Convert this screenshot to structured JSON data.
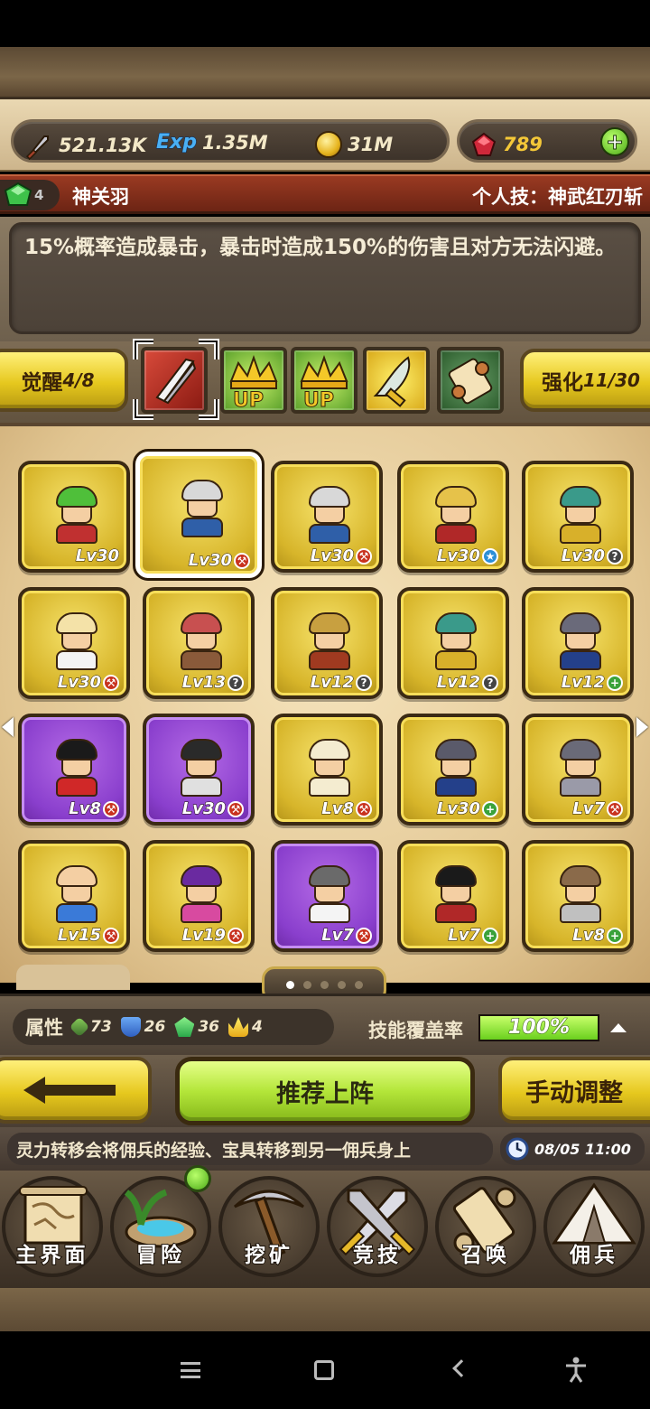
{
  "resources": {
    "attack": "521.13K",
    "exp_label": "Exp",
    "exp": "1.35M",
    "gold": "31M",
    "gems": "789"
  },
  "hero": {
    "gem_count": "4",
    "name": "神关羽",
    "skill": "个人技：神武红刃斩",
    "description": "15%概率造成暴击，暴击时造成150%的伤害且对方无法闪避。"
  },
  "awaken": {
    "label": "觉醒",
    "value": "4/8"
  },
  "enhance": {
    "label": "强化",
    "value": "11/30"
  },
  "skills": [
    {
      "icon": "crossed-swords-icon"
    },
    {
      "icon": "crown-up-icon",
      "label": "UP"
    },
    {
      "icon": "crown-up-icon",
      "label": "UP"
    },
    {
      "icon": "curved-blade-icon"
    },
    {
      "icon": "scroll-icon"
    }
  ],
  "mercenaries": [
    {
      "level": "Lv30",
      "badge": "",
      "color": "gold",
      "hair": "#4fbf3a",
      "outfit": "#c03030"
    },
    {
      "level": "Lv30",
      "badge": "fire",
      "color": "gold",
      "hair": "#d8d8d8",
      "outfit": "#2f5fa8",
      "selected": true
    },
    {
      "level": "Lv30",
      "badge": "fire",
      "color": "gold",
      "hair": "#d8d8d8",
      "outfit": "#2f5fa8"
    },
    {
      "level": "Lv30",
      "badge": "water",
      "color": "gold",
      "hair": "#e6c24a",
      "outfit": "#b02828"
    },
    {
      "level": "Lv30",
      "badge": "q",
      "color": "gold",
      "hair": "#3a9a8a",
      "outfit": "#d8b02a"
    },
    {
      "level": "Lv30",
      "badge": "fire",
      "color": "gold",
      "hair": "#f4e2a8",
      "outfit": "#f4f4f4"
    },
    {
      "level": "Lv13",
      "badge": "q",
      "color": "gold",
      "hair": "#c85050",
      "outfit": "#8a5a3a"
    },
    {
      "level": "Lv12",
      "badge": "q",
      "color": "gold",
      "hair": "#c8a040",
      "outfit": "#a03a20"
    },
    {
      "level": "Lv12",
      "badge": "q",
      "color": "gold",
      "hair": "#3a9a8a",
      "outfit": "#d8b02a"
    },
    {
      "level": "Lv12",
      "badge": "wind",
      "color": "gold",
      "hair": "#6a6a7a",
      "outfit": "#24408a"
    },
    {
      "level": "Lv8",
      "badge": "fire",
      "color": "purple",
      "hair": "#1a1a1a",
      "outfit": "#d02828"
    },
    {
      "level": "Lv30",
      "badge": "fire",
      "color": "purple",
      "hair": "#2a2a2a",
      "outfit": "#e0e0e0"
    },
    {
      "level": "Lv8",
      "badge": "fire",
      "color": "gold",
      "hair": "#f4ecd0",
      "outfit": "#f4ecd0"
    },
    {
      "level": "Lv30",
      "badge": "wind",
      "color": "gold",
      "hair": "#5a5a6a",
      "outfit": "#24408a"
    },
    {
      "level": "Lv7",
      "badge": "fire",
      "color": "gold",
      "hair": "#6a6a78",
      "outfit": "#9a9aa8"
    },
    {
      "level": "Lv15",
      "badge": "fire",
      "color": "gold",
      "hair": "#f4cfa3",
      "outfit": "#3a7ad8"
    },
    {
      "level": "Lv19",
      "badge": "fire",
      "color": "gold",
      "hair": "#6a2aa0",
      "outfit": "#d84aa0"
    },
    {
      "level": "Lv7",
      "badge": "fire",
      "color": "purple",
      "hair": "#6a6a6a",
      "outfit": "#f4f4f4"
    },
    {
      "level": "Lv7",
      "badge": "wind",
      "color": "gold",
      "hair": "#1a1a1a",
      "outfit": "#b02828"
    },
    {
      "level": "Lv8",
      "badge": "wind",
      "color": "gold",
      "hair": "#8a6a4a",
      "outfit": "#c0c0c0"
    }
  ],
  "attributes": {
    "label": "属性",
    "stats": [
      {
        "icon": "leaf-sword-icon",
        "value": "73",
        "color": "#4a8a3a"
      },
      {
        "icon": "shield-icon",
        "value": "26",
        "color": "#2f6fd0"
      },
      {
        "icon": "emerald-icon",
        "value": "36",
        "color": "#2aa84a"
      },
      {
        "icon": "crown-icon",
        "value": "4",
        "color": "#e6b828"
      }
    ],
    "coverage_label": "技能覆盖率",
    "coverage_value": "100%",
    "coverage_fraction": 1.0
  },
  "actions": {
    "recommend": "推荐上阵",
    "manual": "手动调整"
  },
  "tip": {
    "text": "灵力转移会将佣兵的经验、宝具转移到另一佣兵身上",
    "time": "08/05 11:00"
  },
  "nav": [
    {
      "label": "主界面",
      "icon": "map-scroll-icon"
    },
    {
      "label": "冒险",
      "icon": "island-icon"
    },
    {
      "label": "挖矿",
      "icon": "pickaxe-icon"
    },
    {
      "label": "竞技",
      "icon": "crossed-swords-icon"
    },
    {
      "label": "召唤",
      "icon": "summon-scroll-icon"
    },
    {
      "label": "佣兵",
      "icon": "tent-icon"
    }
  ]
}
